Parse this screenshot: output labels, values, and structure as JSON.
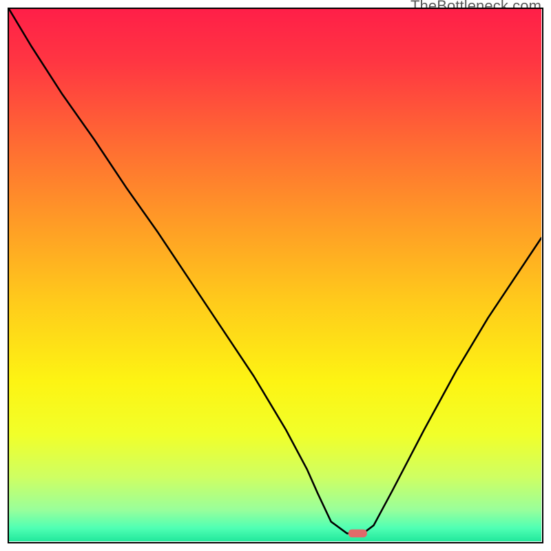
{
  "watermark": "TheBottleneck.com",
  "gradient": {
    "stops": [
      {
        "offset": 0.0,
        "color": "#ff1f48"
      },
      {
        "offset": 0.1,
        "color": "#ff3642"
      },
      {
        "offset": 0.25,
        "color": "#ff6a33"
      },
      {
        "offset": 0.4,
        "color": "#ff9b26"
      },
      {
        "offset": 0.55,
        "color": "#ffcb1b"
      },
      {
        "offset": 0.7,
        "color": "#fdf413"
      },
      {
        "offset": 0.8,
        "color": "#f1ff2a"
      },
      {
        "offset": 0.88,
        "color": "#ceff63"
      },
      {
        "offset": 0.94,
        "color": "#9aff9a"
      },
      {
        "offset": 0.975,
        "color": "#4fffb4"
      },
      {
        "offset": 1.0,
        "color": "#22e89c"
      }
    ]
  },
  "marker": {
    "cx_frac": 0.655,
    "cy_frac": 0.985,
    "w_frac": 0.035,
    "h_frac": 0.015,
    "fill": "#e06a6a"
  },
  "chart_data": {
    "type": "line",
    "title": "",
    "xlabel": "",
    "ylabel": "",
    "xlim": [
      0,
      100
    ],
    "ylim": [
      0,
      100
    ],
    "grid": false,
    "legend": false,
    "series": [
      {
        "name": "bottleneck-curve",
        "x": [
          0.0,
          4.2,
          10.0,
          16.0,
          22.0,
          28.0,
          32.0,
          40.0,
          46.0,
          52.0,
          56.0,
          58.0,
          60.5,
          63.5,
          66.5,
          68.5,
          72.0,
          78.0,
          84.0,
          90.0,
          96.0,
          100.0
        ],
        "y": [
          100.0,
          93.0,
          84.0,
          75.5,
          66.5,
          58.0,
          52.0,
          40.0,
          31.0,
          21.0,
          13.5,
          9.0,
          3.7,
          1.5,
          1.5,
          3.0,
          9.5,
          21.0,
          32.0,
          42.0,
          51.0,
          57.0
        ]
      }
    ],
    "annotations": [
      {
        "type": "marker",
        "x": 65.0,
        "y": 1.5,
        "label": ""
      }
    ]
  }
}
